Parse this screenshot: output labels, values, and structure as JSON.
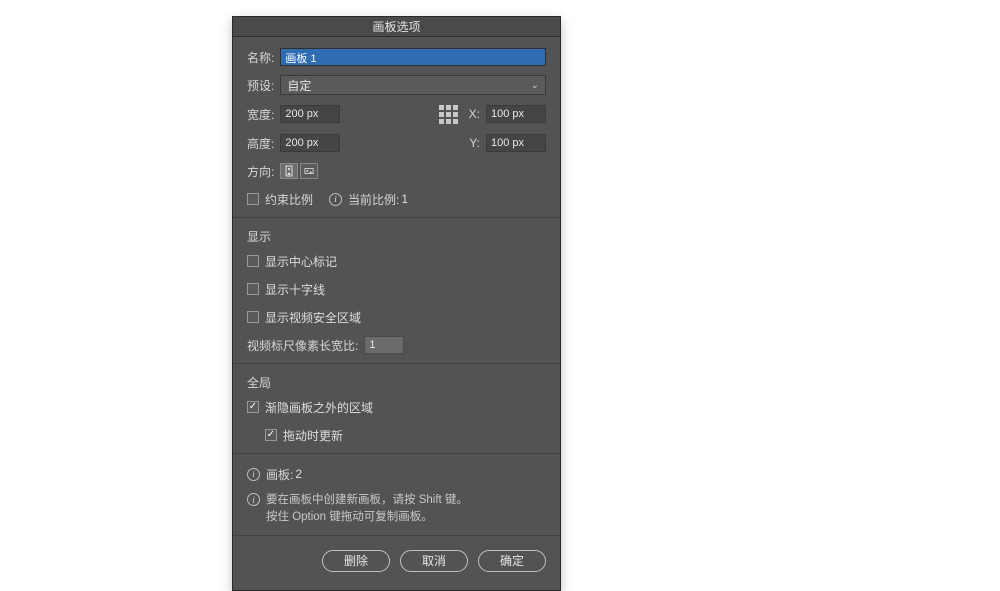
{
  "dialog": {
    "title": "画板选项",
    "name": {
      "label": "名称:",
      "value": "画板 1"
    },
    "preset": {
      "label": "预设:",
      "value": "自定"
    },
    "size": {
      "width_label": "宽度:",
      "width": "200 px",
      "height_label": "高度:",
      "height": "200 px",
      "x_label": "X:",
      "x": "100 px",
      "y_label": "Y:",
      "y": "100 px"
    },
    "orient": {
      "label": "方向:"
    },
    "constrain": {
      "label": "约束比例",
      "checked": false
    },
    "current_ratio": {
      "label": "当前比例:",
      "value": "1"
    },
    "display_heading": "显示",
    "show_center": {
      "label": "显示中心标记",
      "checked": false
    },
    "show_cross": {
      "label": "显示十字线",
      "checked": false
    },
    "show_safe": {
      "label": "显示视频安全区域",
      "checked": false
    },
    "pixel_aspect": {
      "label": "视频标尺像素长宽比:",
      "value": "1"
    },
    "global_heading": "全局",
    "fade_outside": {
      "label": "渐隐画板之外的区域",
      "checked": true
    },
    "update_while_drag": {
      "label": "拖动时更新",
      "checked": true
    },
    "artboard_count": {
      "label": "画板:",
      "value": "2"
    },
    "hint1": "要在画板中创建新画板，请按 Shift 键。",
    "hint2": "按住 Option 键拖动可复制画板。",
    "buttons": {
      "delete": "删除",
      "cancel": "取消",
      "ok": "确定"
    }
  }
}
